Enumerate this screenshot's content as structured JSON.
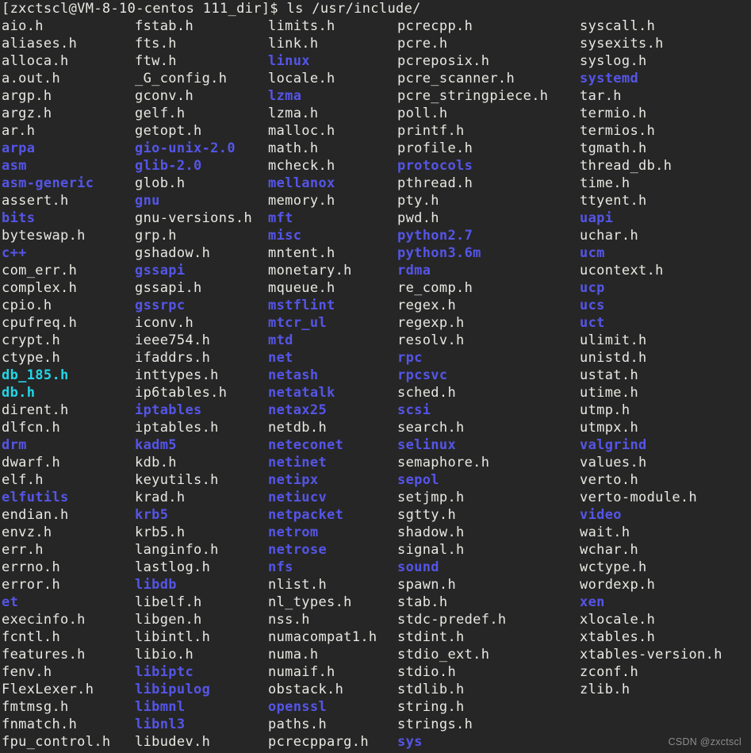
{
  "terminal": {
    "background_color": "#262626",
    "foreground_color": "#e8e8e3",
    "dir_color": "#5555e8",
    "link_color": "#22d6e8",
    "prompt": "[zxctscl@VM-8-10-centos 111_dir]$ ls /usr/include/",
    "ps1": "[zxctscl@VM-8-10-centos 111_dir]$",
    "command": "ls /usr/include/",
    "user": "zxctscl",
    "host": "VM-8-10-centos",
    "cwd": "111_dir",
    "target_path": "/usr/include/"
  },
  "watermark": "CSDN @zxctscl",
  "listing": {
    "columns": [
      {
        "entries": [
          {
            "name": "aio.h",
            "type": "file"
          },
          {
            "name": "aliases.h",
            "type": "file"
          },
          {
            "name": "alloca.h",
            "type": "file"
          },
          {
            "name": "a.out.h",
            "type": "file"
          },
          {
            "name": "argp.h",
            "type": "file"
          },
          {
            "name": "argz.h",
            "type": "file"
          },
          {
            "name": "ar.h",
            "type": "file"
          },
          {
            "name": "arpa",
            "type": "dir"
          },
          {
            "name": "asm",
            "type": "dir"
          },
          {
            "name": "asm-generic",
            "type": "dir"
          },
          {
            "name": "assert.h",
            "type": "file"
          },
          {
            "name": "bits",
            "type": "dir"
          },
          {
            "name": "byteswap.h",
            "type": "file"
          },
          {
            "name": "c++",
            "type": "dir"
          },
          {
            "name": "com_err.h",
            "type": "file"
          },
          {
            "name": "complex.h",
            "type": "file"
          },
          {
            "name": "cpio.h",
            "type": "file"
          },
          {
            "name": "cpufreq.h",
            "type": "file"
          },
          {
            "name": "crypt.h",
            "type": "file"
          },
          {
            "name": "ctype.h",
            "type": "file"
          },
          {
            "name": "db_185.h",
            "type": "link"
          },
          {
            "name": "db.h",
            "type": "link"
          },
          {
            "name": "dirent.h",
            "type": "file"
          },
          {
            "name": "dlfcn.h",
            "type": "file"
          },
          {
            "name": "drm",
            "type": "dir"
          },
          {
            "name": "dwarf.h",
            "type": "file"
          },
          {
            "name": "elf.h",
            "type": "file"
          },
          {
            "name": "elfutils",
            "type": "dir"
          },
          {
            "name": "endian.h",
            "type": "file"
          },
          {
            "name": "envz.h",
            "type": "file"
          },
          {
            "name": "err.h",
            "type": "file"
          },
          {
            "name": "errno.h",
            "type": "file"
          },
          {
            "name": "error.h",
            "type": "file"
          },
          {
            "name": "et",
            "type": "dir"
          },
          {
            "name": "execinfo.h",
            "type": "file"
          },
          {
            "name": "fcntl.h",
            "type": "file"
          },
          {
            "name": "features.h",
            "type": "file"
          },
          {
            "name": "fenv.h",
            "type": "file"
          },
          {
            "name": "FlexLexer.h",
            "type": "file"
          },
          {
            "name": "fmtmsg.h",
            "type": "file"
          },
          {
            "name": "fnmatch.h",
            "type": "file"
          },
          {
            "name": "fpu_control.h",
            "type": "file"
          }
        ]
      },
      {
        "entries": [
          {
            "name": "fstab.h",
            "type": "file"
          },
          {
            "name": "fts.h",
            "type": "file"
          },
          {
            "name": "ftw.h",
            "type": "file"
          },
          {
            "name": "_G_config.h",
            "type": "file"
          },
          {
            "name": "gconv.h",
            "type": "file"
          },
          {
            "name": "gelf.h",
            "type": "file"
          },
          {
            "name": "getopt.h",
            "type": "file"
          },
          {
            "name": "gio-unix-2.0",
            "type": "dir"
          },
          {
            "name": "glib-2.0",
            "type": "dir"
          },
          {
            "name": "glob.h",
            "type": "file"
          },
          {
            "name": "gnu",
            "type": "dir"
          },
          {
            "name": "gnu-versions.h",
            "type": "file"
          },
          {
            "name": "grp.h",
            "type": "file"
          },
          {
            "name": "gshadow.h",
            "type": "file"
          },
          {
            "name": "gssapi",
            "type": "dir"
          },
          {
            "name": "gssapi.h",
            "type": "file"
          },
          {
            "name": "gssrpc",
            "type": "dir"
          },
          {
            "name": "iconv.h",
            "type": "file"
          },
          {
            "name": "ieee754.h",
            "type": "file"
          },
          {
            "name": "ifaddrs.h",
            "type": "file"
          },
          {
            "name": "inttypes.h",
            "type": "file"
          },
          {
            "name": "ip6tables.h",
            "type": "file"
          },
          {
            "name": "iptables",
            "type": "dir"
          },
          {
            "name": "iptables.h",
            "type": "file"
          },
          {
            "name": "kadm5",
            "type": "dir"
          },
          {
            "name": "kdb.h",
            "type": "file"
          },
          {
            "name": "keyutils.h",
            "type": "file"
          },
          {
            "name": "krad.h",
            "type": "file"
          },
          {
            "name": "krb5",
            "type": "dir"
          },
          {
            "name": "krb5.h",
            "type": "file"
          },
          {
            "name": "langinfo.h",
            "type": "file"
          },
          {
            "name": "lastlog.h",
            "type": "file"
          },
          {
            "name": "libdb",
            "type": "dir"
          },
          {
            "name": "libelf.h",
            "type": "file"
          },
          {
            "name": "libgen.h",
            "type": "file"
          },
          {
            "name": "libintl.h",
            "type": "file"
          },
          {
            "name": "libio.h",
            "type": "file"
          },
          {
            "name": "libiptc",
            "type": "dir"
          },
          {
            "name": "libipulog",
            "type": "dir"
          },
          {
            "name": "libmnl",
            "type": "dir"
          },
          {
            "name": "libnl3",
            "type": "dir"
          },
          {
            "name": "libudev.h",
            "type": "file"
          }
        ]
      },
      {
        "entries": [
          {
            "name": "limits.h",
            "type": "file"
          },
          {
            "name": "link.h",
            "type": "file"
          },
          {
            "name": "linux",
            "type": "dir"
          },
          {
            "name": "locale.h",
            "type": "file"
          },
          {
            "name": "lzma",
            "type": "dir"
          },
          {
            "name": "lzma.h",
            "type": "file"
          },
          {
            "name": "malloc.h",
            "type": "file"
          },
          {
            "name": "math.h",
            "type": "file"
          },
          {
            "name": "mcheck.h",
            "type": "file"
          },
          {
            "name": "mellanox",
            "type": "dir"
          },
          {
            "name": "memory.h",
            "type": "file"
          },
          {
            "name": "mft",
            "type": "dir"
          },
          {
            "name": "misc",
            "type": "dir"
          },
          {
            "name": "mntent.h",
            "type": "file"
          },
          {
            "name": "monetary.h",
            "type": "file"
          },
          {
            "name": "mqueue.h",
            "type": "file"
          },
          {
            "name": "mstflint",
            "type": "dir"
          },
          {
            "name": "mtcr_ul",
            "type": "dir"
          },
          {
            "name": "mtd",
            "type": "dir"
          },
          {
            "name": "net",
            "type": "dir"
          },
          {
            "name": "netash",
            "type": "dir"
          },
          {
            "name": "netatalk",
            "type": "dir"
          },
          {
            "name": "netax25",
            "type": "dir"
          },
          {
            "name": "netdb.h",
            "type": "file"
          },
          {
            "name": "neteconet",
            "type": "dir"
          },
          {
            "name": "netinet",
            "type": "dir"
          },
          {
            "name": "netipx",
            "type": "dir"
          },
          {
            "name": "netiucv",
            "type": "dir"
          },
          {
            "name": "netpacket",
            "type": "dir"
          },
          {
            "name": "netrom",
            "type": "dir"
          },
          {
            "name": "netrose",
            "type": "dir"
          },
          {
            "name": "nfs",
            "type": "dir"
          },
          {
            "name": "nlist.h",
            "type": "file"
          },
          {
            "name": "nl_types.h",
            "type": "file"
          },
          {
            "name": "nss.h",
            "type": "file"
          },
          {
            "name": "numacompat1.h",
            "type": "file"
          },
          {
            "name": "numa.h",
            "type": "file"
          },
          {
            "name": "numaif.h",
            "type": "file"
          },
          {
            "name": "obstack.h",
            "type": "file"
          },
          {
            "name": "openssl",
            "type": "dir"
          },
          {
            "name": "paths.h",
            "type": "file"
          },
          {
            "name": "pcrecpparg.h",
            "type": "file"
          }
        ]
      },
      {
        "entries": [
          {
            "name": "pcrecpp.h",
            "type": "file"
          },
          {
            "name": "pcre.h",
            "type": "file"
          },
          {
            "name": "pcreposix.h",
            "type": "file"
          },
          {
            "name": "pcre_scanner.h",
            "type": "file"
          },
          {
            "name": "pcre_stringpiece.h",
            "type": "file"
          },
          {
            "name": "poll.h",
            "type": "file"
          },
          {
            "name": "printf.h",
            "type": "file"
          },
          {
            "name": "profile.h",
            "type": "file"
          },
          {
            "name": "protocols",
            "type": "dir"
          },
          {
            "name": "pthread.h",
            "type": "file"
          },
          {
            "name": "pty.h",
            "type": "file"
          },
          {
            "name": "pwd.h",
            "type": "file"
          },
          {
            "name": "python2.7",
            "type": "dir"
          },
          {
            "name": "python3.6m",
            "type": "dir"
          },
          {
            "name": "rdma",
            "type": "dir"
          },
          {
            "name": "re_comp.h",
            "type": "file"
          },
          {
            "name": "regex.h",
            "type": "file"
          },
          {
            "name": "regexp.h",
            "type": "file"
          },
          {
            "name": "resolv.h",
            "type": "file"
          },
          {
            "name": "rpc",
            "type": "dir"
          },
          {
            "name": "rpcsvc",
            "type": "dir"
          },
          {
            "name": "sched.h",
            "type": "file"
          },
          {
            "name": "scsi",
            "type": "dir"
          },
          {
            "name": "search.h",
            "type": "file"
          },
          {
            "name": "selinux",
            "type": "dir"
          },
          {
            "name": "semaphore.h",
            "type": "file"
          },
          {
            "name": "sepol",
            "type": "dir"
          },
          {
            "name": "setjmp.h",
            "type": "file"
          },
          {
            "name": "sgtty.h",
            "type": "file"
          },
          {
            "name": "shadow.h",
            "type": "file"
          },
          {
            "name": "signal.h",
            "type": "file"
          },
          {
            "name": "sound",
            "type": "dir"
          },
          {
            "name": "spawn.h",
            "type": "file"
          },
          {
            "name": "stab.h",
            "type": "file"
          },
          {
            "name": "stdc-predef.h",
            "type": "file"
          },
          {
            "name": "stdint.h",
            "type": "file"
          },
          {
            "name": "stdio_ext.h",
            "type": "file"
          },
          {
            "name": "stdio.h",
            "type": "file"
          },
          {
            "name": "stdlib.h",
            "type": "file"
          },
          {
            "name": "string.h",
            "type": "file"
          },
          {
            "name": "strings.h",
            "type": "file"
          },
          {
            "name": "sys",
            "type": "dir"
          }
        ]
      },
      {
        "entries": [
          {
            "name": "syscall.h",
            "type": "file"
          },
          {
            "name": "sysexits.h",
            "type": "file"
          },
          {
            "name": "syslog.h",
            "type": "file"
          },
          {
            "name": "systemd",
            "type": "dir"
          },
          {
            "name": "tar.h",
            "type": "file"
          },
          {
            "name": "termio.h",
            "type": "file"
          },
          {
            "name": "termios.h",
            "type": "file"
          },
          {
            "name": "tgmath.h",
            "type": "file"
          },
          {
            "name": "thread_db.h",
            "type": "file"
          },
          {
            "name": "time.h",
            "type": "file"
          },
          {
            "name": "ttyent.h",
            "type": "file"
          },
          {
            "name": "uapi",
            "type": "dir"
          },
          {
            "name": "uchar.h",
            "type": "file"
          },
          {
            "name": "ucm",
            "type": "dir"
          },
          {
            "name": "ucontext.h",
            "type": "file"
          },
          {
            "name": "ucp",
            "type": "dir"
          },
          {
            "name": "ucs",
            "type": "dir"
          },
          {
            "name": "uct",
            "type": "dir"
          },
          {
            "name": "ulimit.h",
            "type": "file"
          },
          {
            "name": "unistd.h",
            "type": "file"
          },
          {
            "name": "ustat.h",
            "type": "file"
          },
          {
            "name": "utime.h",
            "type": "file"
          },
          {
            "name": "utmp.h",
            "type": "file"
          },
          {
            "name": "utmpx.h",
            "type": "file"
          },
          {
            "name": "valgrind",
            "type": "dir"
          },
          {
            "name": "values.h",
            "type": "file"
          },
          {
            "name": "verto.h",
            "type": "file"
          },
          {
            "name": "verto-module.h",
            "type": "file"
          },
          {
            "name": "video",
            "type": "dir"
          },
          {
            "name": "wait.h",
            "type": "file"
          },
          {
            "name": "wchar.h",
            "type": "file"
          },
          {
            "name": "wctype.h",
            "type": "file"
          },
          {
            "name": "wordexp.h",
            "type": "file"
          },
          {
            "name": "xen",
            "type": "dir"
          },
          {
            "name": "xlocale.h",
            "type": "file"
          },
          {
            "name": "xtables.h",
            "type": "file"
          },
          {
            "name": "xtables-version.h",
            "type": "file"
          },
          {
            "name": "zconf.h",
            "type": "file"
          },
          {
            "name": "zlib.h",
            "type": "file"
          }
        ]
      }
    ]
  }
}
